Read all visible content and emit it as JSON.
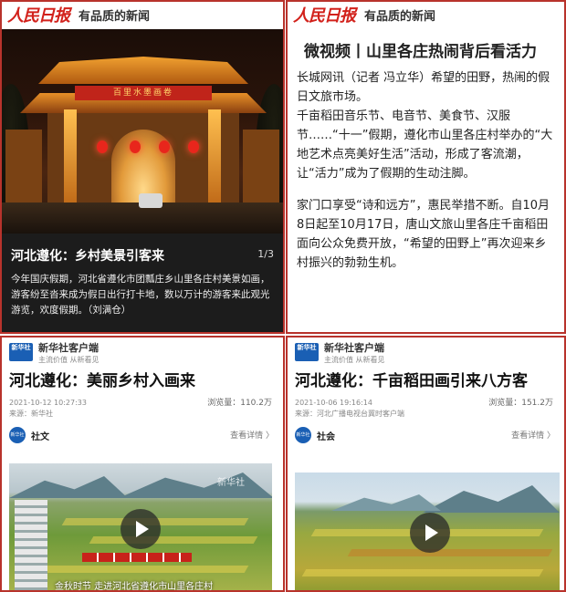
{
  "people_daily": {
    "logo_text": "人民日报",
    "slogan": "有品质的新闻"
  },
  "panel1": {
    "gate_sign": "百里水墨画卷",
    "caption_title": "河北遵化：乡村美景引客来",
    "caption_index": "1/3",
    "caption_text": "今年国庆假期，河北省遵化市团瓢庄乡山里各庄村美景如画，游客纷至沓来成为假日出行打卡地，数以万计的游客来此观光游览，欢度假期。（刘满仓）"
  },
  "panel2": {
    "title": "微视频丨山里各庄热闹背后看活力",
    "paragraphs": [
      "长城网讯（记者 冯立华）希望的田野，热闹的假日文旅市场。",
      "千亩稻田音乐节、电音节、美食节、汉服节……“十一”假期，遵化市山里各庄村举办的“大地艺术点亮美好生活”活动，形成了客流潮，让“活力”成为了假期的生动注脚。",
      "家门口享受“诗和远方”，惠民举措不断。自10月8日起至10月17日，唐山文旅山里各庄千亩稻田面向公众免费开放，“希望的田野上”再次迎来乡村振兴的勃勃生机。"
    ]
  },
  "xinhua": {
    "logo_text": "新华社",
    "name": "新华社客户端",
    "sub": "主流价值 从新看见"
  },
  "panel3": {
    "title": "河北遵化：美丽乡村入画来",
    "date": "2021-10-12 10:27:33",
    "source": "来源：新华社",
    "views": "浏览量：110.2万",
    "category_icon": "新华社",
    "category": "社文",
    "detail": "查看详情 〉",
    "video_caption": "金秋时节 走进河北省遵化市山里各庄村",
    "watermark": "新华社"
  },
  "panel4": {
    "title": "河北遵化：千亩稻田画引来八方客",
    "date": "2021-10-06 19:16:14",
    "source": "来源：河北广播电视台冀时客户端",
    "views": "浏览量：151.2万",
    "category_icon": "新华社",
    "category": "社会",
    "detail": "查看详情 〉"
  },
  "colors": {
    "accent_red": "#b8332c",
    "people_daily_red": "#d2211b",
    "xinhua_blue": "#1a5fb4"
  }
}
